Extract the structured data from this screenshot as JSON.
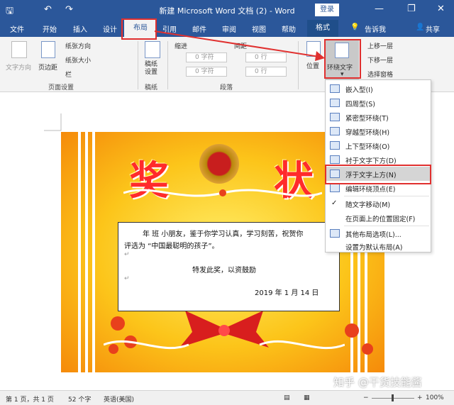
{
  "title_bar": {
    "title": "新建 Microsoft Word 文档 (2)  -  Word",
    "login": "登录",
    "minimize": "—",
    "restore": "❐",
    "close": "✕"
  },
  "quick_access": {
    "save": "🖫",
    "undo": "↶",
    "redo": "↷"
  },
  "tabs": {
    "file": "文件",
    "home": "开始",
    "insert": "插入",
    "design": "设计",
    "layout": "布局",
    "references": "引用",
    "mailings": "邮件",
    "review": "审阅",
    "view": "视图",
    "help": "帮助",
    "format": "格式",
    "tell_me": "告诉我",
    "share": "共享"
  },
  "ribbon": {
    "text_direction": "文字方向",
    "margins": "页边距",
    "orientation": "纸张方向",
    "size": "纸张大小",
    "columns": "栏",
    "manuscript": "稿纸\n设置",
    "indent": "缩进",
    "spacing": "间距",
    "indent_left": "0 字符",
    "indent_right": "0 字符",
    "spacing_before": "0 行",
    "spacing_after": "0 行",
    "position": "位置",
    "wrap_text": "环绕文字",
    "bring_forward": "上移一层",
    "send_backward": "下移一层",
    "selection_pane": "选择窗格",
    "group_page_setup": "页面设置",
    "group_manuscript": "稿纸",
    "group_paragraph": "段落"
  },
  "wrap_menu": {
    "items": [
      "嵌入型(I)",
      "四周型(S)",
      "紧密型环绕(T)",
      "穿越型环绕(H)",
      "上下型环绕(O)",
      "衬于文字下方(D)",
      "浮于文字上方(N)",
      "编辑环绕顶点(E)",
      "随文字移动(M)",
      "在页面上的位置固定(F)",
      "其他布局选项(L)...",
      "设置为默认布局(A)"
    ],
    "check": "✓"
  },
  "certificate": {
    "char_left": "奖",
    "char_right": "状",
    "line1": "年  班  小朋友，鉴于你学习认真，学习刻苦，祝贺你",
    "line2": "评选为 “中国最聪明的孩子”。",
    "line3": "特发此奖，以资鼓励",
    "date": "2019 年 1 月 14 日",
    "mark": "↵"
  },
  "status_bar": {
    "page": "第 1 页，共 1 页",
    "words": "52 个字",
    "lang": "英语(美国)",
    "zoom": "100%",
    "zoom_minus": "−",
    "zoom_plus": "+"
  },
  "watermark": "知乎 @干货技能酱",
  "colors": {
    "word_blue": "#2b579a",
    "highlight_red": "#e0302f"
  }
}
